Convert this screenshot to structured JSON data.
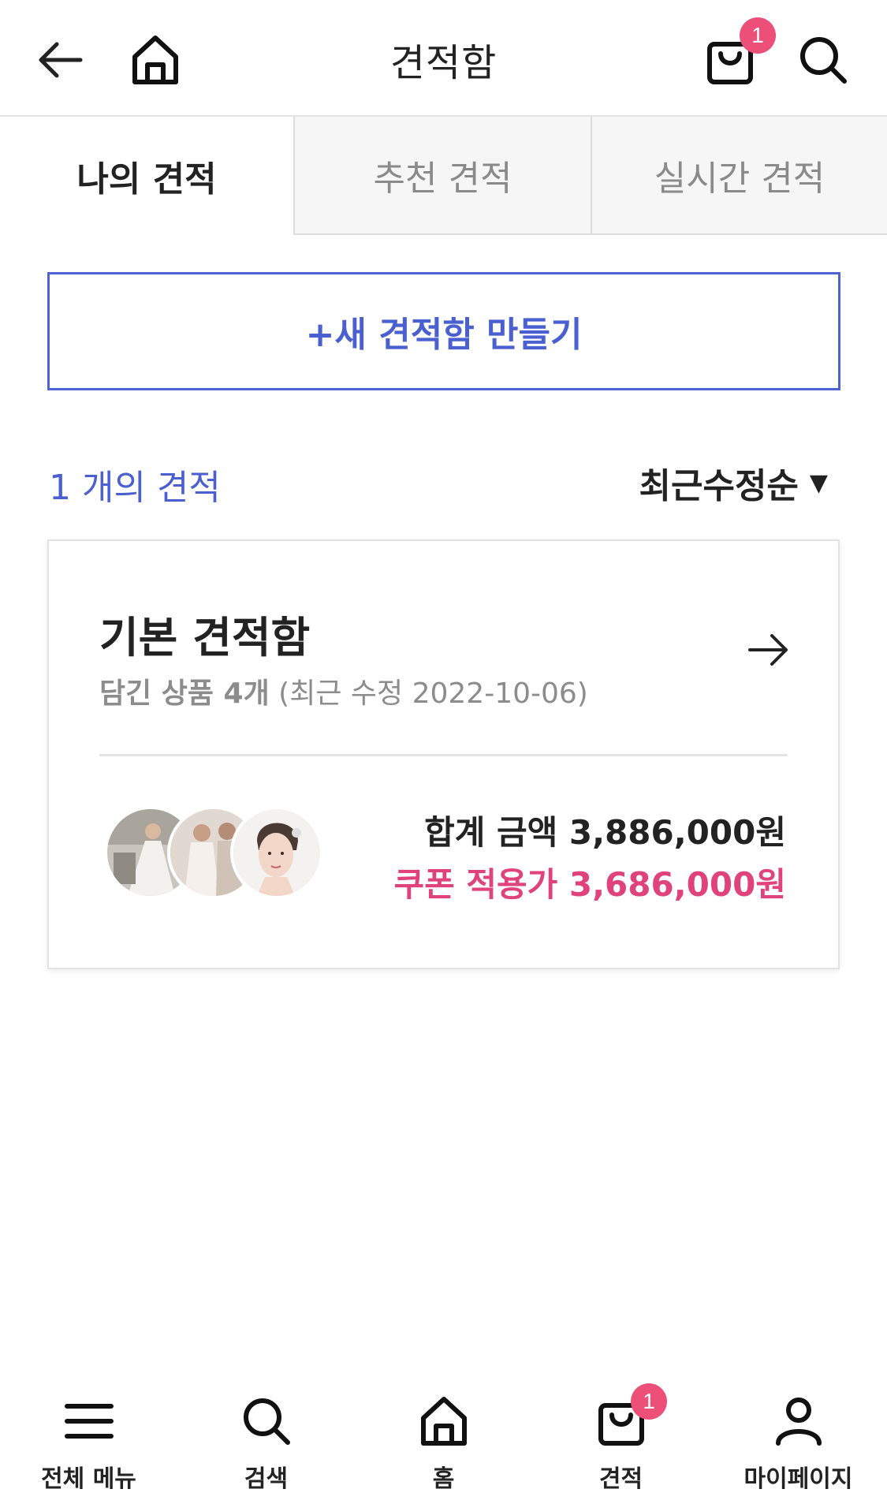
{
  "header": {
    "title": "견적함",
    "back_icon": "arrow-left-icon",
    "home_icon": "home-icon",
    "cart_icon": "shopping-bag-icon",
    "cart_badge": "1",
    "search_icon": "search-icon"
  },
  "tabs": [
    {
      "label": "나의 견적",
      "active": true
    },
    {
      "label": "추천 견적",
      "active": false
    },
    {
      "label": "실시간 견적",
      "active": false
    }
  ],
  "new_box_button": {
    "label": "+새 견적함 만들기"
  },
  "list": {
    "count_text": "1 개의 견적",
    "sort_label": "최근수정순",
    "sort_caret": "▼"
  },
  "card": {
    "title": "기본 견적함",
    "items_label": "담긴 상품 4개",
    "modified_text": "(최근 수정 2022-10-06)",
    "total_label": "합계 금액 3,886,000원",
    "coupon_label": "쿠폰 적용가 3,686,000원"
  },
  "bottom_nav": [
    {
      "label": "전체 메뉴",
      "icon": "menu-icon"
    },
    {
      "label": "검색",
      "icon": "search-icon"
    },
    {
      "label": "홈",
      "icon": "home-icon"
    },
    {
      "label": "견적",
      "icon": "shopping-bag-icon",
      "badge": "1"
    },
    {
      "label": "마이페이지",
      "icon": "user-icon"
    }
  ],
  "colors": {
    "accent_blue": "#4a5fd0",
    "accent_pink": "#e0427b",
    "badge_pink": "#ec4f78"
  }
}
